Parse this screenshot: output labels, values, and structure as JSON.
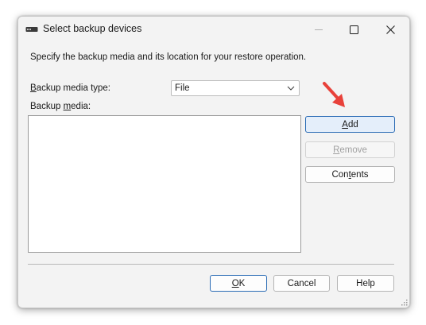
{
  "window": {
    "title": "Select backup devices",
    "minimize_icon": "minimize-icon",
    "maximize_icon": "maximize-icon",
    "close_icon": "close-icon"
  },
  "instruction": "Specify the backup media and its location for your restore operation.",
  "media_type": {
    "label_prefix": "B",
    "label_rest": "ackup media type:",
    "selected": "File",
    "options": [
      "File"
    ]
  },
  "media_list": {
    "label_prefix": "Backup ",
    "label_accel": "m",
    "label_rest": "edia:",
    "items": []
  },
  "side_buttons": {
    "add_accel": "A",
    "add_rest": "dd",
    "remove_accel": "R",
    "remove_rest": "emove",
    "contents_pre": "Con",
    "contents_accel": "t",
    "contents_rest": "ents"
  },
  "footer": {
    "ok_accel": "O",
    "ok_rest": "K",
    "cancel": "Cancel",
    "help": "Help"
  },
  "colors": {
    "accent": "#2b6cb5",
    "annotation_arrow": "#e8413a"
  }
}
